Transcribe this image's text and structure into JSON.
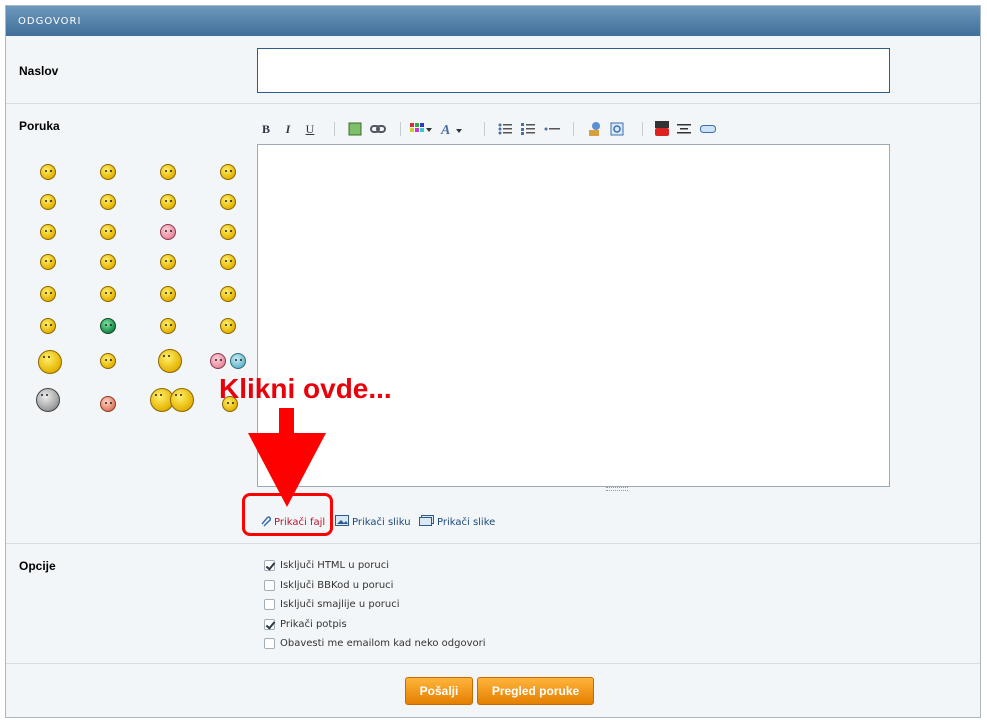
{
  "header": {
    "title": "ODGOVORI"
  },
  "fields": {
    "title_label": "Naslov",
    "title_value": "",
    "message_label": "Poruka",
    "options_label": "Opcije"
  },
  "toolbar": {
    "items": [
      "B",
      "I",
      "U"
    ]
  },
  "attachments": {
    "attach_file": "Prikači fajl",
    "attach_image": "Prikači sliku",
    "attach_images": "Prikači slike"
  },
  "callout": {
    "text": "Klikni ovde..."
  },
  "options": [
    {
      "label": "Isključi HTML u poruci",
      "checked": true
    },
    {
      "label": "Isključi BBKod u poruci",
      "checked": false
    },
    {
      "label": "Isključi smajlije u poruci",
      "checked": false
    },
    {
      "label": "Prikači potpis",
      "checked": true
    },
    {
      "label": "Obavesti me emailom kad neko odgovori",
      "checked": false
    }
  ],
  "buttons": {
    "send": "Pošalji",
    "preview": "Pregled poruke"
  },
  "colors": {
    "header": "#4a7ba6",
    "button": "#f09a1a",
    "callout": "#ff0000"
  }
}
